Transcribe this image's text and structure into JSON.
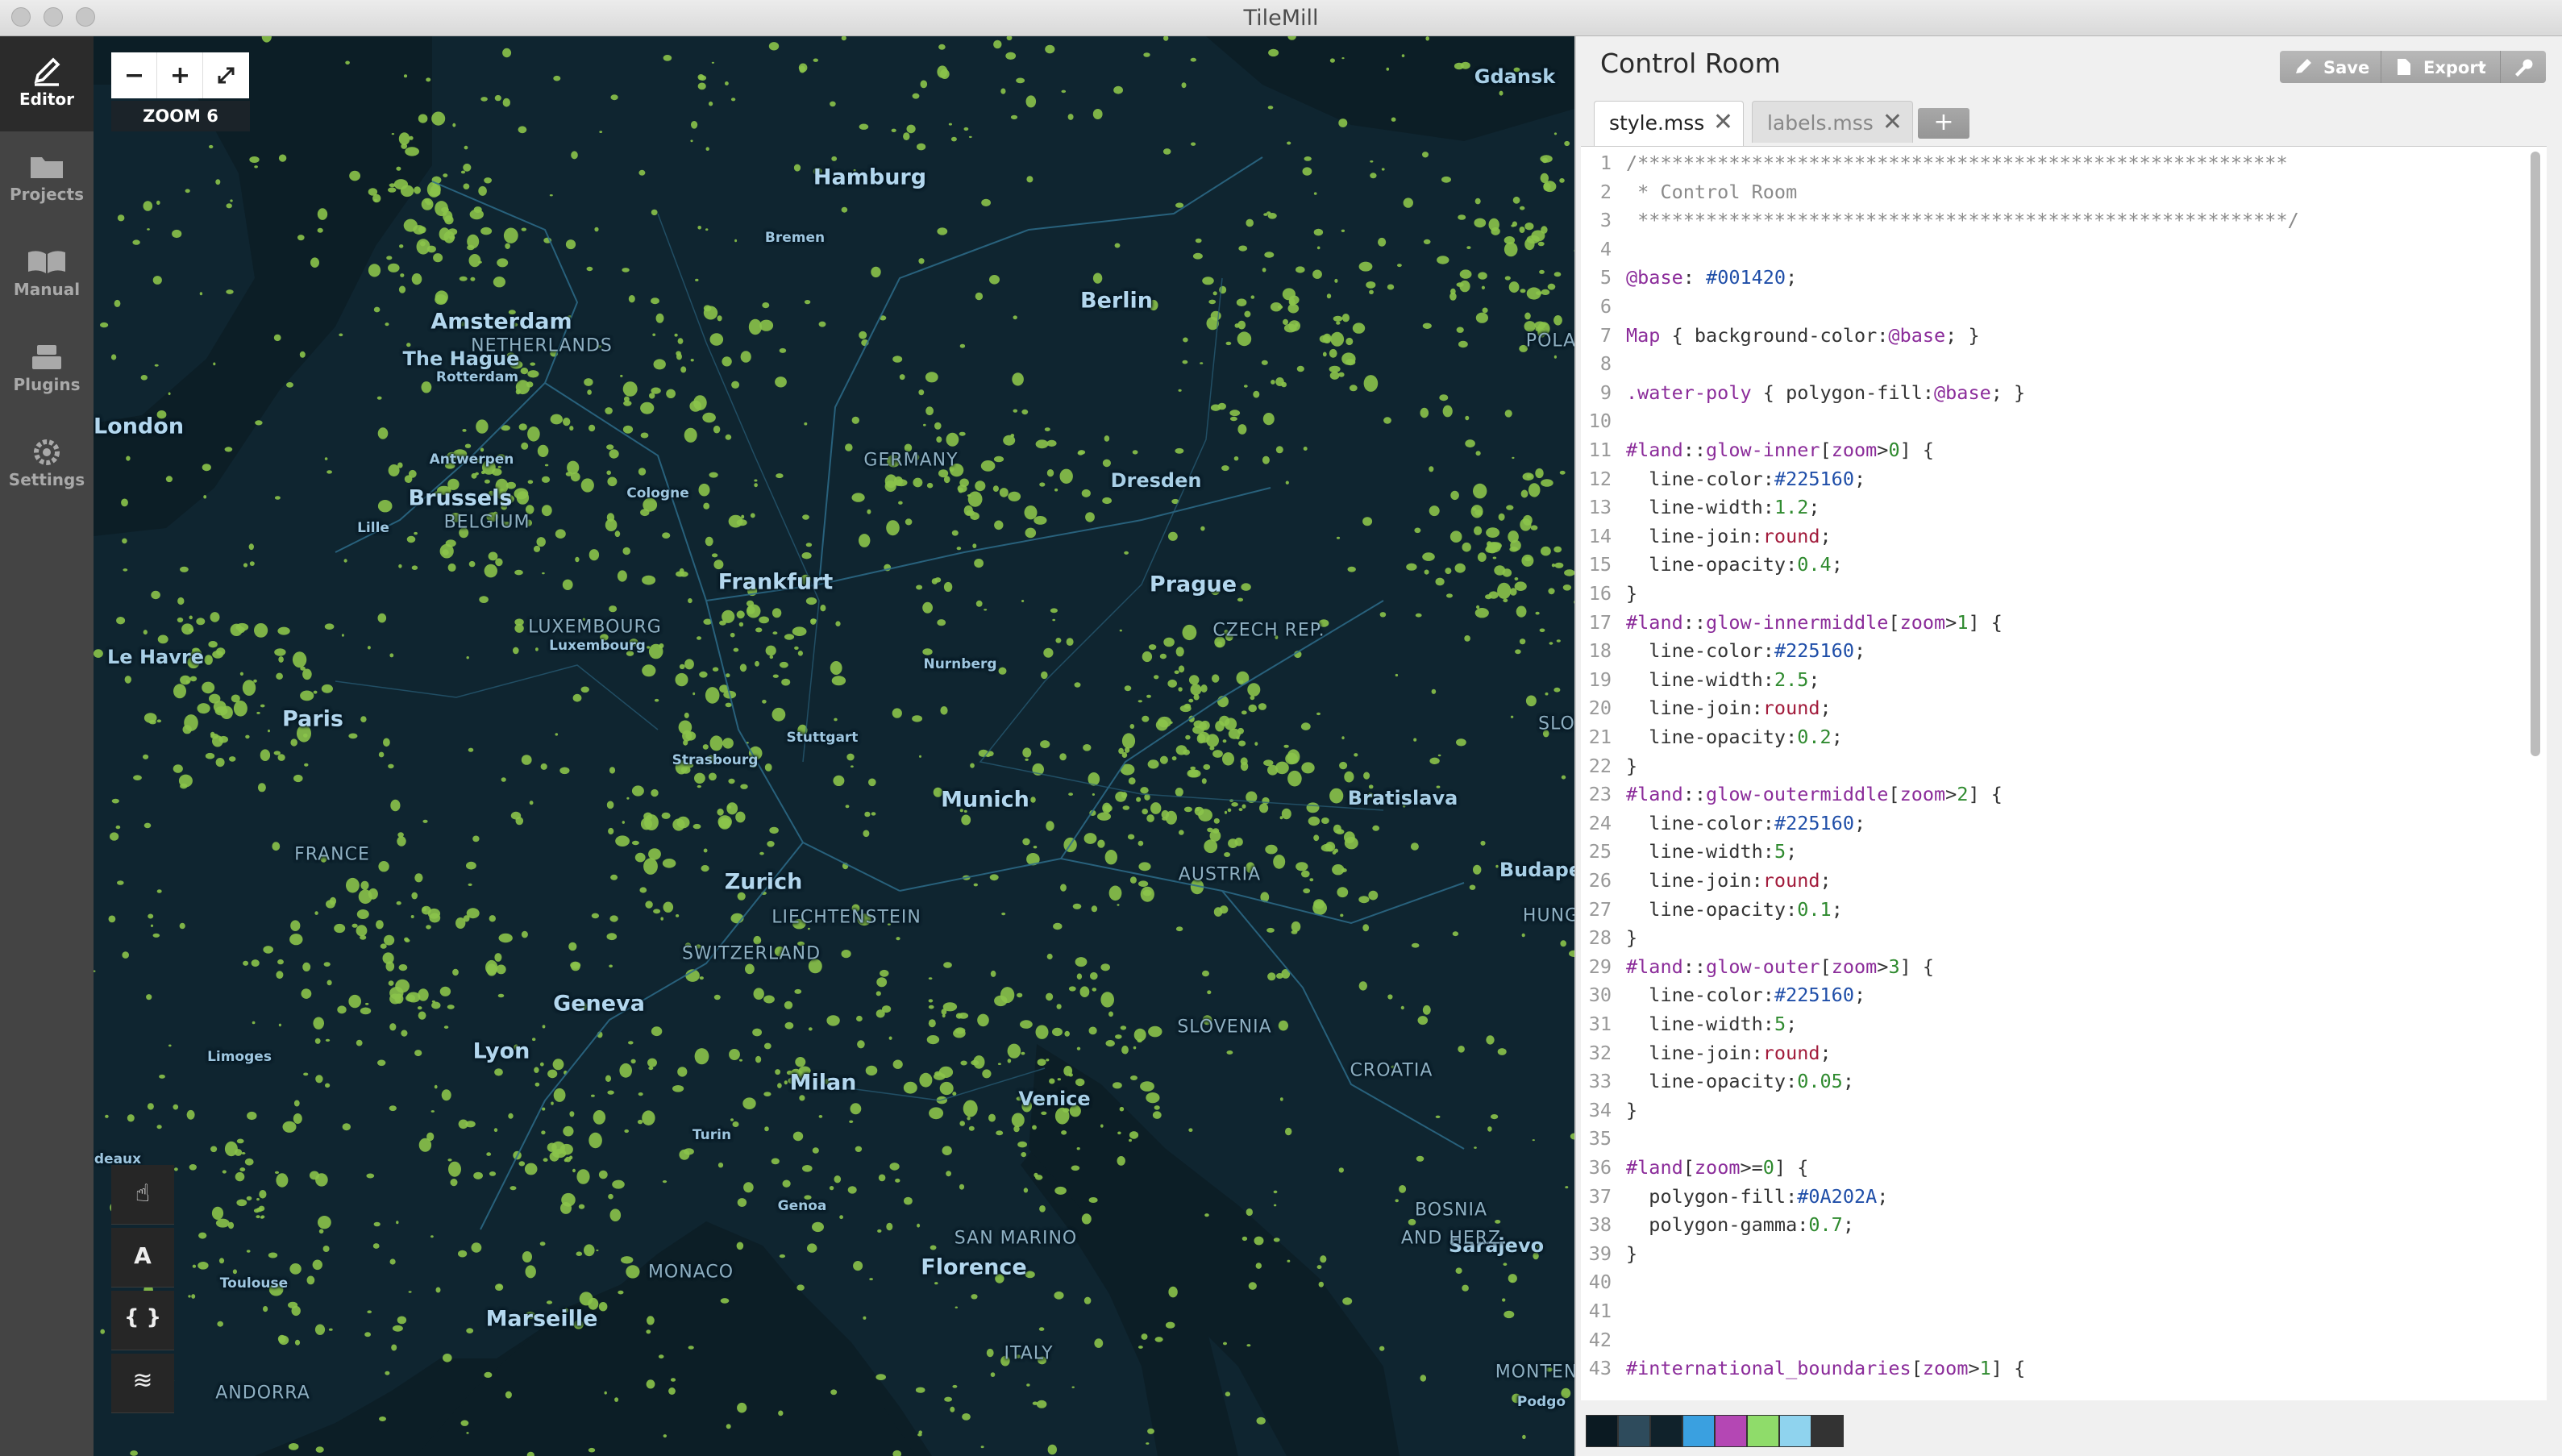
{
  "window": {
    "title": "TileMill"
  },
  "sidebar": {
    "items": [
      {
        "label": "Editor",
        "icon": "pencil-icon",
        "active": true
      },
      {
        "label": "Projects",
        "icon": "folder-icon",
        "active": false
      },
      {
        "label": "Manual",
        "icon": "book-icon",
        "active": false
      },
      {
        "label": "Plugins",
        "icon": "plugin-icon",
        "active": false
      },
      {
        "label": "Settings",
        "icon": "gear-icon",
        "active": false
      }
    ]
  },
  "map": {
    "zoom_label": "ZOOM 6",
    "controls": [
      {
        "label": "−",
        "icon": "zoom-out-icon"
      },
      {
        "label": "+",
        "icon": "zoom-in-icon"
      },
      {
        "label": "⤢",
        "icon": "fullscreen-icon"
      }
    ],
    "colors": {
      "water": "#0c1e26",
      "land": "#0A202A",
      "urban": "#8bc34a",
      "boundary": "#225160"
    },
    "labels": {
      "cities_large": [
        "Hamburg",
        "Berlin",
        "Amsterdam",
        "Brussels",
        "Frankfurt",
        "Prague",
        "Paris",
        "Munich",
        "Zurich",
        "Geneva",
        "Milan",
        "Lyon",
        "Marseille",
        "Florence",
        "London",
        "Dresden",
        "Bratislava",
        "Sarajevo",
        "Budape",
        "Venice",
        "The Hague",
        "Le Havre",
        "Gdansk"
      ],
      "cities_small": [
        "Bremen",
        "Rotterdam",
        "Antwerpen",
        "Cologne",
        "Lille",
        "Luxembourg",
        "Nurnberg",
        "Stuttgart",
        "Strasbourg",
        "Turin",
        "Genoa",
        "Limoges",
        "Toulouse",
        "Podgo",
        "deaux"
      ],
      "countries": [
        "NETHERLANDS",
        "BELGIUM",
        "GERMANY",
        "LUXEMBOURG",
        "CZECH REP.",
        "FRANCE",
        "AUSTRIA",
        "LIECHTENSTEIN",
        "SWITZERLAND",
        "SLOVENIA",
        "CROATIA",
        "BOSNIA",
        "AND HERZ.",
        "MONACO",
        "SAN MARINO",
        "ITALY",
        "ANDORRA",
        "POLA",
        "SLO",
        "HUNG",
        "MONTEN"
      ]
    }
  },
  "tools": [
    {
      "icon": "hand-icon",
      "glyph": "☝"
    },
    {
      "icon": "font-icon",
      "glyph": "A"
    },
    {
      "icon": "braces-icon",
      "glyph": "{ }"
    },
    {
      "icon": "layers-icon",
      "glyph": "≋"
    }
  ],
  "editor": {
    "project_title": "Control Room",
    "buttons": {
      "save": "Save",
      "export": "Export",
      "export_menu": "▾",
      "settings": "wrench-icon"
    },
    "tabs": [
      {
        "name": "style.mss",
        "active": true
      },
      {
        "name": "labels.mss",
        "active": false
      }
    ],
    "add_tab": "+",
    "code": [
      {
        "n": "1",
        "t": "/*********************************************************"
      },
      {
        "n": "2",
        "t": " * Control Room"
      },
      {
        "n": "3",
        "t": " *********************************************************/"
      },
      {
        "n": "4",
        "t": ""
      },
      {
        "n": "5",
        "t": "@base: #001420;"
      },
      {
        "n": "6",
        "t": ""
      },
      {
        "n": "7",
        "t": "Map { background-color:@base; }"
      },
      {
        "n": "8",
        "t": ""
      },
      {
        "n": "9",
        "t": ".water-poly { polygon-fill:@base; }"
      },
      {
        "n": "10",
        "t": ""
      },
      {
        "n": "11",
        "t": "#land::glow-inner[zoom>0] {"
      },
      {
        "n": "12",
        "t": "  line-color:#225160;"
      },
      {
        "n": "13",
        "t": "  line-width:1.2;"
      },
      {
        "n": "14",
        "t": "  line-join:round;"
      },
      {
        "n": "15",
        "t": "  line-opacity:0.4;"
      },
      {
        "n": "16",
        "t": "}"
      },
      {
        "n": "17",
        "t": "#land::glow-innermiddle[zoom>1] {"
      },
      {
        "n": "18",
        "t": "  line-color:#225160;"
      },
      {
        "n": "19",
        "t": "  line-width:2.5;"
      },
      {
        "n": "20",
        "t": "  line-join:round;"
      },
      {
        "n": "21",
        "t": "  line-opacity:0.2;"
      },
      {
        "n": "22",
        "t": "}"
      },
      {
        "n": "23",
        "t": "#land::glow-outermiddle[zoom>2] {"
      },
      {
        "n": "24",
        "t": "  line-color:#225160;"
      },
      {
        "n": "25",
        "t": "  line-width:5;"
      },
      {
        "n": "26",
        "t": "  line-join:round;"
      },
      {
        "n": "27",
        "t": "  line-opacity:0.1;"
      },
      {
        "n": "28",
        "t": "}"
      },
      {
        "n": "29",
        "t": "#land::glow-outer[zoom>3] {"
      },
      {
        "n": "30",
        "t": "  line-color:#225160;"
      },
      {
        "n": "31",
        "t": "  line-width:5;"
      },
      {
        "n": "32",
        "t": "  line-join:round;"
      },
      {
        "n": "33",
        "t": "  line-opacity:0.05;"
      },
      {
        "n": "34",
        "t": "}"
      },
      {
        "n": "35",
        "t": ""
      },
      {
        "n": "36",
        "t": "#land[zoom>=0] {"
      },
      {
        "n": "37",
        "t": "  polygon-fill:#0A202A;"
      },
      {
        "n": "38",
        "t": "  polygon-gamma:0.7;"
      },
      {
        "n": "39",
        "t": "}"
      },
      {
        "n": "40",
        "t": ""
      },
      {
        "n": "41",
        "t": ""
      },
      {
        "n": "42",
        "t": ""
      },
      {
        "n": "43",
        "t": "#international_boundaries[zoom>1] {"
      }
    ],
    "palette": [
      "#0b1a22",
      "#2e4b5c",
      "#10222b",
      "#3aa0e0",
      "#b447b4",
      "#8fdc6a",
      "#8fd3ee",
      "#333333"
    ]
  }
}
